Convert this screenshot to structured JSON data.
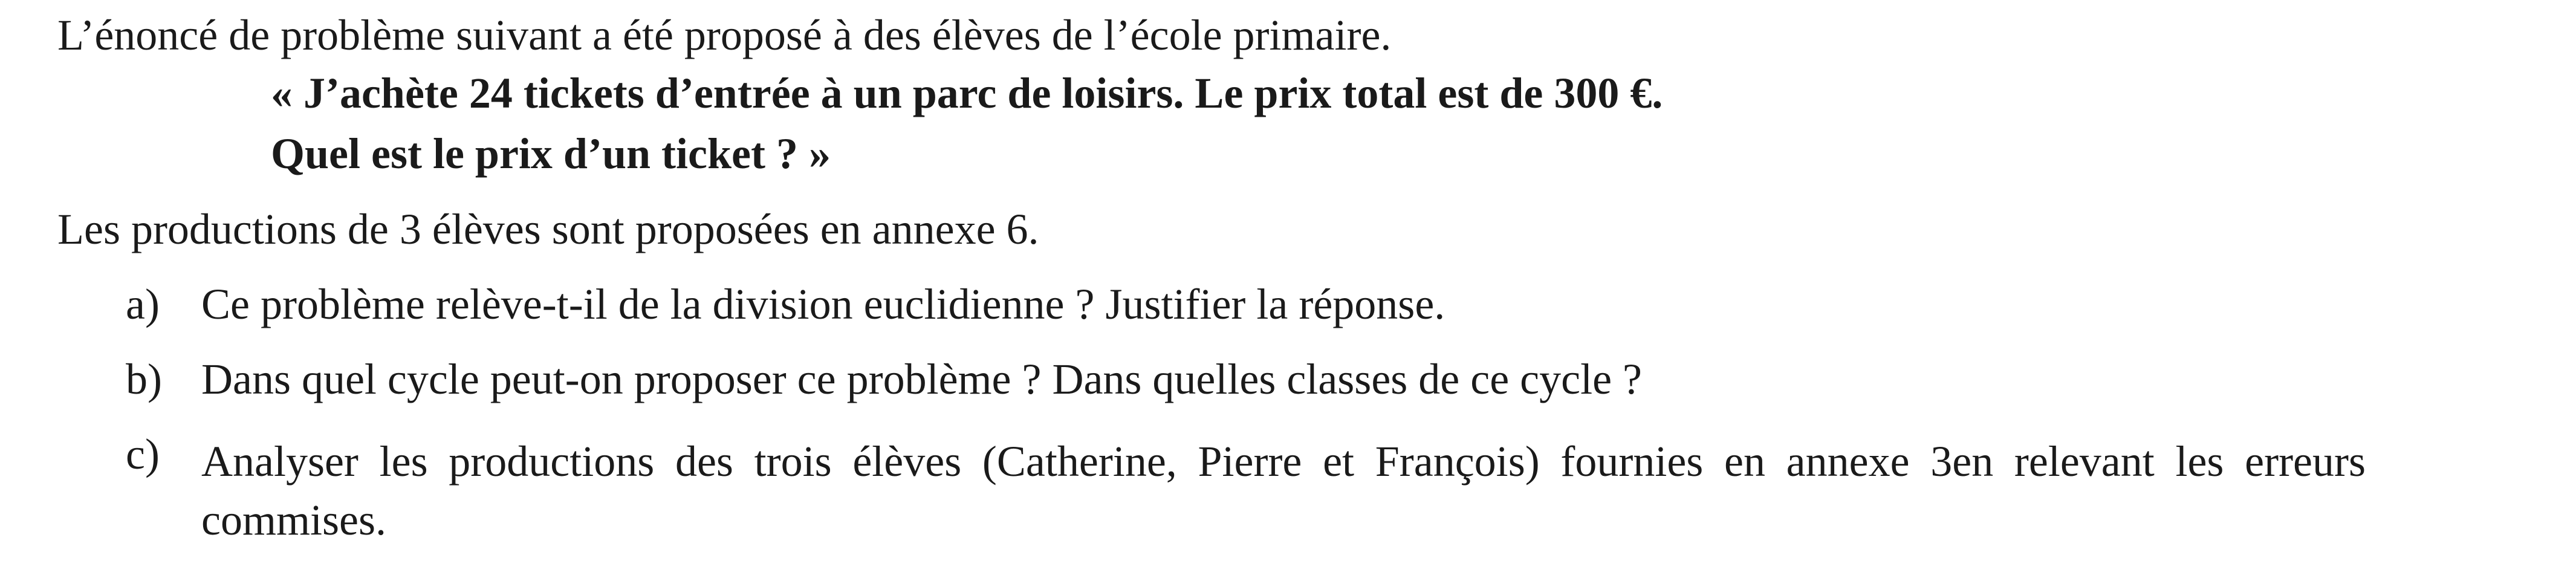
{
  "document": {
    "intro": "L’énoncé de problème suivant a été proposé à des élèves de l’école primaire.",
    "problem": {
      "line1": "« J’achète 24 tickets d’entrée à un parc de loisirs. Le prix total est de 300 €.",
      "line2": "Quel est le prix d’un ticket ? »"
    },
    "annexe_note": "Les productions de 3 élèves sont proposées en annexe 6.",
    "questions": [
      {
        "label": "a)",
        "text": "Ce problème relève-t-il de la division euclidienne ? Justifier la réponse."
      },
      {
        "label": "b)",
        "text": "Dans quel cycle peut-on proposer ce problème ? Dans quelles classes de ce cycle ?"
      },
      {
        "label": "c)",
        "text": "Analyser les productions des trois élèves (Catherine, Pierre et François) fournies en annexe 3en relevant les erreurs commises."
      }
    ]
  }
}
